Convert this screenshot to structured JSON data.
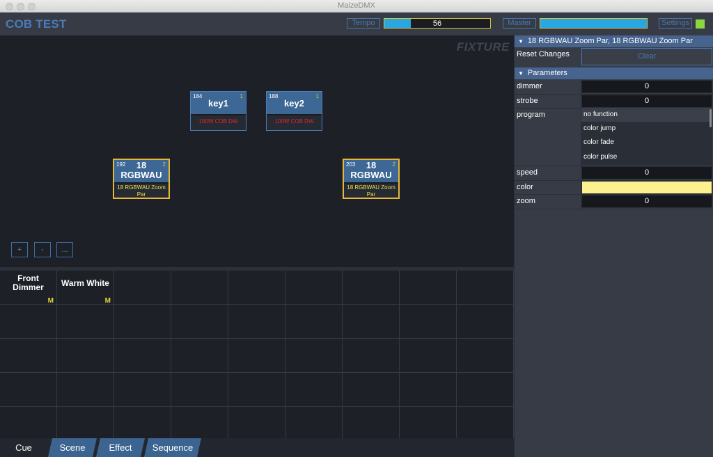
{
  "window": {
    "title": "MaizeDMX"
  },
  "header": {
    "app_title": "COB TEST",
    "tempo_label": "Tempo",
    "tempo_value": "56",
    "tempo_level": 0.25,
    "master_label": "Master",
    "master_level": 1.0,
    "settings_label": "Settings",
    "status_color": "#8cd640"
  },
  "stage": {
    "label": "FIXTURE",
    "fixtures": [
      {
        "number": "184",
        "count": "1",
        "name": "key1",
        "type": "100W COB DW",
        "type_color": "#e0272c",
        "selected": false
      },
      {
        "number": "188",
        "count": "1",
        "name": "key2",
        "type": "100W COB DW",
        "type_color": "#e0272c",
        "selected": false
      },
      {
        "number": "192",
        "count": "2",
        "name_line1": "18",
        "name_line2": "RGBWAU",
        "type_line1": "18 RGBWAU Zoom",
        "type_line2": "Par",
        "type_color": "#f0e04a",
        "selected": true
      },
      {
        "number": "203",
        "count": "2",
        "name_line1": "18",
        "name_line2": "RGBWAU",
        "type_line1": "18 RGBWAU Zoom",
        "type_line2": "Par",
        "type_color": "#f0e04a",
        "selected": true
      }
    ],
    "buttons": {
      "add": "+",
      "remove": "-",
      "more": "..."
    }
  },
  "cues": {
    "items": [
      {
        "line1": "Front",
        "line2": "Dimmer",
        "badge": "M"
      },
      {
        "line1": "Warm White",
        "line2": "",
        "badge": "M"
      }
    ]
  },
  "tabs": [
    {
      "label": "Cue",
      "active": true
    },
    {
      "label": "Scene",
      "active": false
    },
    {
      "label": "Effect",
      "active": false
    },
    {
      "label": "Sequence",
      "active": false
    }
  ],
  "panel": {
    "selection_title": "18 RGBWAU Zoom Par, 18 RGBWAU Zoom Par",
    "reset_label": "Reset Changes",
    "clear_label": "Clear",
    "parameters_title": "Parameters",
    "dimmer": {
      "label": "dimmer",
      "value": "0"
    },
    "strobe": {
      "label": "strobe",
      "value": "0"
    },
    "program": {
      "label": "program",
      "options": [
        "no function",
        "color jump",
        "color fade",
        "color pulse"
      ],
      "selected": "no function"
    },
    "speed": {
      "label": "speed",
      "value": "0"
    },
    "color": {
      "label": "color",
      "value_color": "#fdf08e"
    },
    "zoom": {
      "label": "zoom",
      "value": "0"
    }
  }
}
